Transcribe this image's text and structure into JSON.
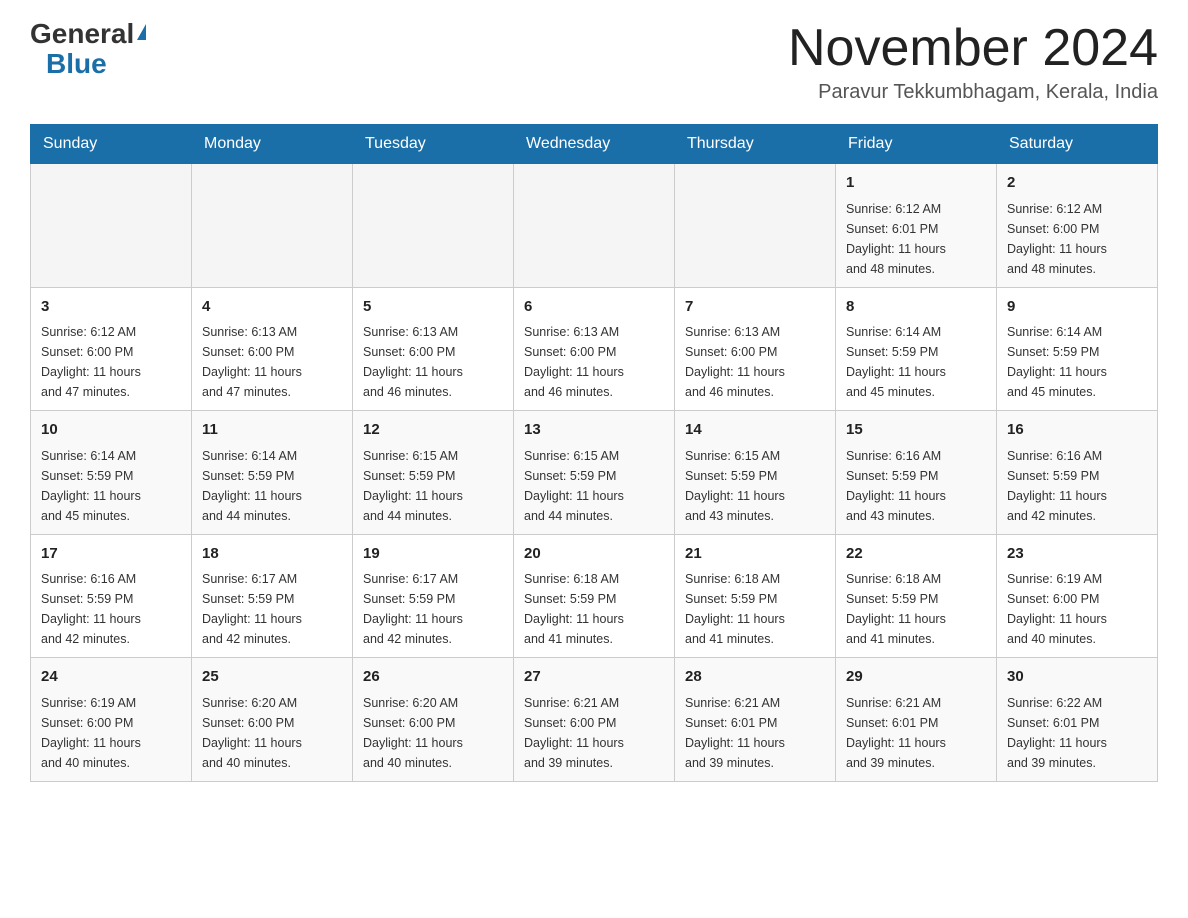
{
  "header": {
    "logo_general": "General",
    "logo_blue": "Blue",
    "month_title": "November 2024",
    "location": "Paravur Tekkumbhagam, Kerala, India"
  },
  "days_of_week": [
    "Sunday",
    "Monday",
    "Tuesday",
    "Wednesday",
    "Thursday",
    "Friday",
    "Saturday"
  ],
  "weeks": [
    [
      {
        "day": "",
        "info": ""
      },
      {
        "day": "",
        "info": ""
      },
      {
        "day": "",
        "info": ""
      },
      {
        "day": "",
        "info": ""
      },
      {
        "day": "",
        "info": ""
      },
      {
        "day": "1",
        "info": "Sunrise: 6:12 AM\nSunset: 6:01 PM\nDaylight: 11 hours\nand 48 minutes."
      },
      {
        "day": "2",
        "info": "Sunrise: 6:12 AM\nSunset: 6:00 PM\nDaylight: 11 hours\nand 48 minutes."
      }
    ],
    [
      {
        "day": "3",
        "info": "Sunrise: 6:12 AM\nSunset: 6:00 PM\nDaylight: 11 hours\nand 47 minutes."
      },
      {
        "day": "4",
        "info": "Sunrise: 6:13 AM\nSunset: 6:00 PM\nDaylight: 11 hours\nand 47 minutes."
      },
      {
        "day": "5",
        "info": "Sunrise: 6:13 AM\nSunset: 6:00 PM\nDaylight: 11 hours\nand 46 minutes."
      },
      {
        "day": "6",
        "info": "Sunrise: 6:13 AM\nSunset: 6:00 PM\nDaylight: 11 hours\nand 46 minutes."
      },
      {
        "day": "7",
        "info": "Sunrise: 6:13 AM\nSunset: 6:00 PM\nDaylight: 11 hours\nand 46 minutes."
      },
      {
        "day": "8",
        "info": "Sunrise: 6:14 AM\nSunset: 5:59 PM\nDaylight: 11 hours\nand 45 minutes."
      },
      {
        "day": "9",
        "info": "Sunrise: 6:14 AM\nSunset: 5:59 PM\nDaylight: 11 hours\nand 45 minutes."
      }
    ],
    [
      {
        "day": "10",
        "info": "Sunrise: 6:14 AM\nSunset: 5:59 PM\nDaylight: 11 hours\nand 45 minutes."
      },
      {
        "day": "11",
        "info": "Sunrise: 6:14 AM\nSunset: 5:59 PM\nDaylight: 11 hours\nand 44 minutes."
      },
      {
        "day": "12",
        "info": "Sunrise: 6:15 AM\nSunset: 5:59 PM\nDaylight: 11 hours\nand 44 minutes."
      },
      {
        "day": "13",
        "info": "Sunrise: 6:15 AM\nSunset: 5:59 PM\nDaylight: 11 hours\nand 44 minutes."
      },
      {
        "day": "14",
        "info": "Sunrise: 6:15 AM\nSunset: 5:59 PM\nDaylight: 11 hours\nand 43 minutes."
      },
      {
        "day": "15",
        "info": "Sunrise: 6:16 AM\nSunset: 5:59 PM\nDaylight: 11 hours\nand 43 minutes."
      },
      {
        "day": "16",
        "info": "Sunrise: 6:16 AM\nSunset: 5:59 PM\nDaylight: 11 hours\nand 42 minutes."
      }
    ],
    [
      {
        "day": "17",
        "info": "Sunrise: 6:16 AM\nSunset: 5:59 PM\nDaylight: 11 hours\nand 42 minutes."
      },
      {
        "day": "18",
        "info": "Sunrise: 6:17 AM\nSunset: 5:59 PM\nDaylight: 11 hours\nand 42 minutes."
      },
      {
        "day": "19",
        "info": "Sunrise: 6:17 AM\nSunset: 5:59 PM\nDaylight: 11 hours\nand 42 minutes."
      },
      {
        "day": "20",
        "info": "Sunrise: 6:18 AM\nSunset: 5:59 PM\nDaylight: 11 hours\nand 41 minutes."
      },
      {
        "day": "21",
        "info": "Sunrise: 6:18 AM\nSunset: 5:59 PM\nDaylight: 11 hours\nand 41 minutes."
      },
      {
        "day": "22",
        "info": "Sunrise: 6:18 AM\nSunset: 5:59 PM\nDaylight: 11 hours\nand 41 minutes."
      },
      {
        "day": "23",
        "info": "Sunrise: 6:19 AM\nSunset: 6:00 PM\nDaylight: 11 hours\nand 40 minutes."
      }
    ],
    [
      {
        "day": "24",
        "info": "Sunrise: 6:19 AM\nSunset: 6:00 PM\nDaylight: 11 hours\nand 40 minutes."
      },
      {
        "day": "25",
        "info": "Sunrise: 6:20 AM\nSunset: 6:00 PM\nDaylight: 11 hours\nand 40 minutes."
      },
      {
        "day": "26",
        "info": "Sunrise: 6:20 AM\nSunset: 6:00 PM\nDaylight: 11 hours\nand 40 minutes."
      },
      {
        "day": "27",
        "info": "Sunrise: 6:21 AM\nSunset: 6:00 PM\nDaylight: 11 hours\nand 39 minutes."
      },
      {
        "day": "28",
        "info": "Sunrise: 6:21 AM\nSunset: 6:01 PM\nDaylight: 11 hours\nand 39 minutes."
      },
      {
        "day": "29",
        "info": "Sunrise: 6:21 AM\nSunset: 6:01 PM\nDaylight: 11 hours\nand 39 minutes."
      },
      {
        "day": "30",
        "info": "Sunrise: 6:22 AM\nSunset: 6:01 PM\nDaylight: 11 hours\nand 39 minutes."
      }
    ]
  ]
}
